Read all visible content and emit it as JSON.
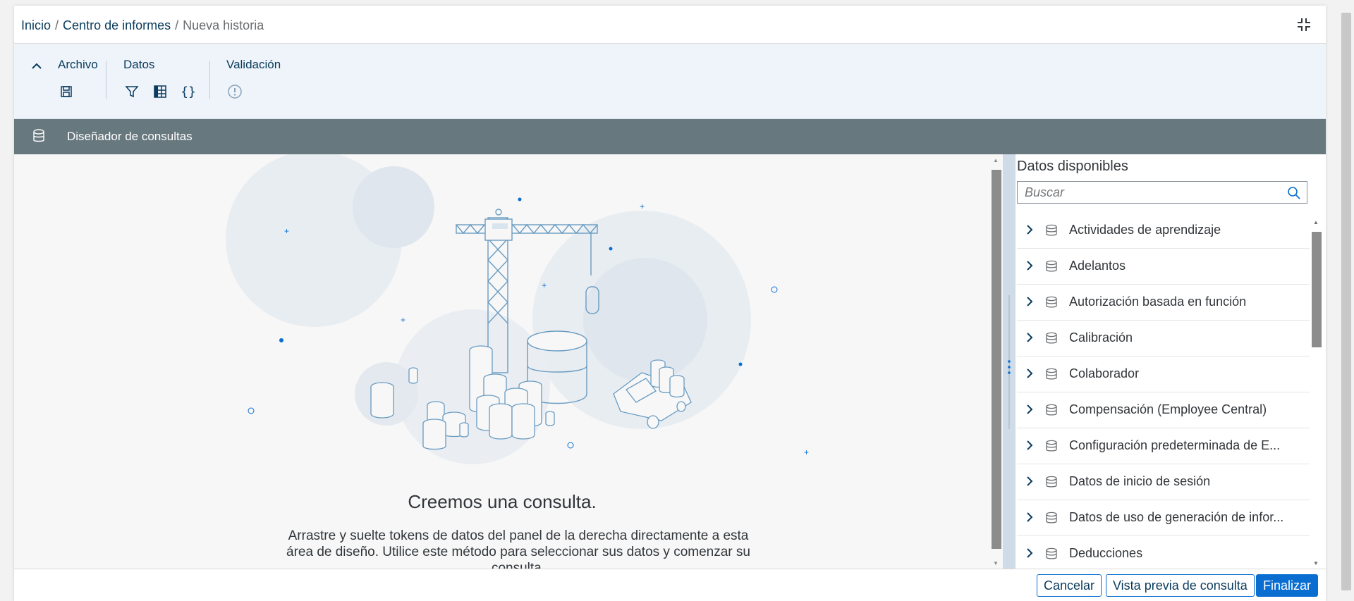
{
  "breadcrumb": {
    "items": [
      "Inicio",
      "Centro de informes"
    ],
    "current": "Nueva historia",
    "separator": "/"
  },
  "toolbar": {
    "groups": [
      {
        "title": "Archivo",
        "icons": [
          "save-icon"
        ]
      },
      {
        "title": "Datos",
        "icons": [
          "filter-icon",
          "table-icon",
          "formula-icon"
        ]
      },
      {
        "title": "Validación",
        "icons": [
          "warning-icon"
        ]
      }
    ]
  },
  "designer": {
    "title": "Diseñador de consultas",
    "icon": "database-icon"
  },
  "canvas": {
    "empty_title": "Creemos una consulta.",
    "empty_description": "Arrastre y suelte tokens de datos del panel de la derecha directamente a esta área de diseño. Utilice este método para seleccionar sus datos y comenzar su consulta."
  },
  "panel": {
    "title": "Datos disponibles",
    "search_placeholder": "Buscar",
    "items": [
      "Actividades de aprendizaje",
      "Adelantos",
      "Autorización basada en función",
      "Calibración",
      "Colaborador",
      "Compensación (Employee Central)",
      "Configuración predeterminada de E...",
      "Datos de inicio de sesión",
      "Datos de uso de generación de infor...",
      "Deducciones"
    ]
  },
  "footer": {
    "cancel": "Cancelar",
    "preview": "Vista previa de consulta",
    "finish": "Finalizar"
  },
  "colors": {
    "accent": "#0a6ed1",
    "designer_bar": "#68787f",
    "toolbar_bg": "#eef4fa"
  }
}
